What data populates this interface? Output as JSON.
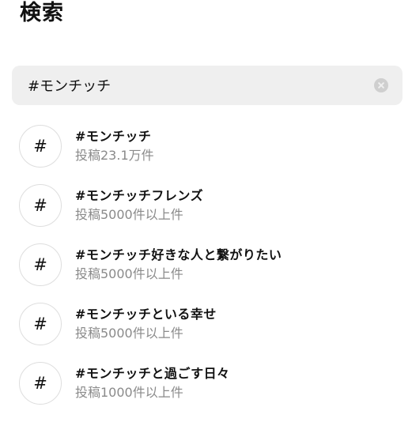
{
  "page": {
    "title": "検索"
  },
  "search": {
    "value": "#モンチッチ",
    "clear_icon": "clear-circle-x-icon"
  },
  "results": [
    {
      "icon": "#",
      "title": "#モンチッチ",
      "count": "投稿23.1万件"
    },
    {
      "icon": "#",
      "title": "#モンチッチフレンズ",
      "count": "投稿5000件以上件"
    },
    {
      "icon": "#",
      "title": "#モンチッチ好きな人と繋がりたい",
      "count": "投稿5000件以上件"
    },
    {
      "icon": "#",
      "title": "#モンチッチといる幸せ",
      "count": "投稿5000件以上件"
    },
    {
      "icon": "#",
      "title": "#モンチッチと過ごす日々",
      "count": "投稿1000件以上件"
    }
  ]
}
